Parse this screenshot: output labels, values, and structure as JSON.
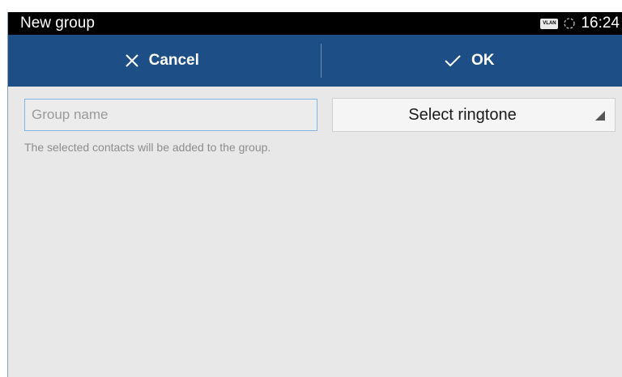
{
  "status_bar": {
    "title": "New group",
    "time": "16:24",
    "vlan_badge": "VLAN",
    "icons": [
      "vlan-icon",
      "sync-icon"
    ]
  },
  "action_bar": {
    "cancel_label": "Cancel",
    "ok_label": "OK",
    "cancel_icon": "close-icon",
    "ok_icon": "checkmark-icon"
  },
  "form": {
    "group_name_placeholder": "Group name",
    "group_name_value": "",
    "ringtone_label": "Select ringtone",
    "hint": "The selected contacts will be added to the group."
  },
  "colors": {
    "status_bar": "#000000",
    "action_bar": "#1d4f86",
    "body_background": "#e8e8e8",
    "input_focus_border": "#7fb6e6"
  }
}
